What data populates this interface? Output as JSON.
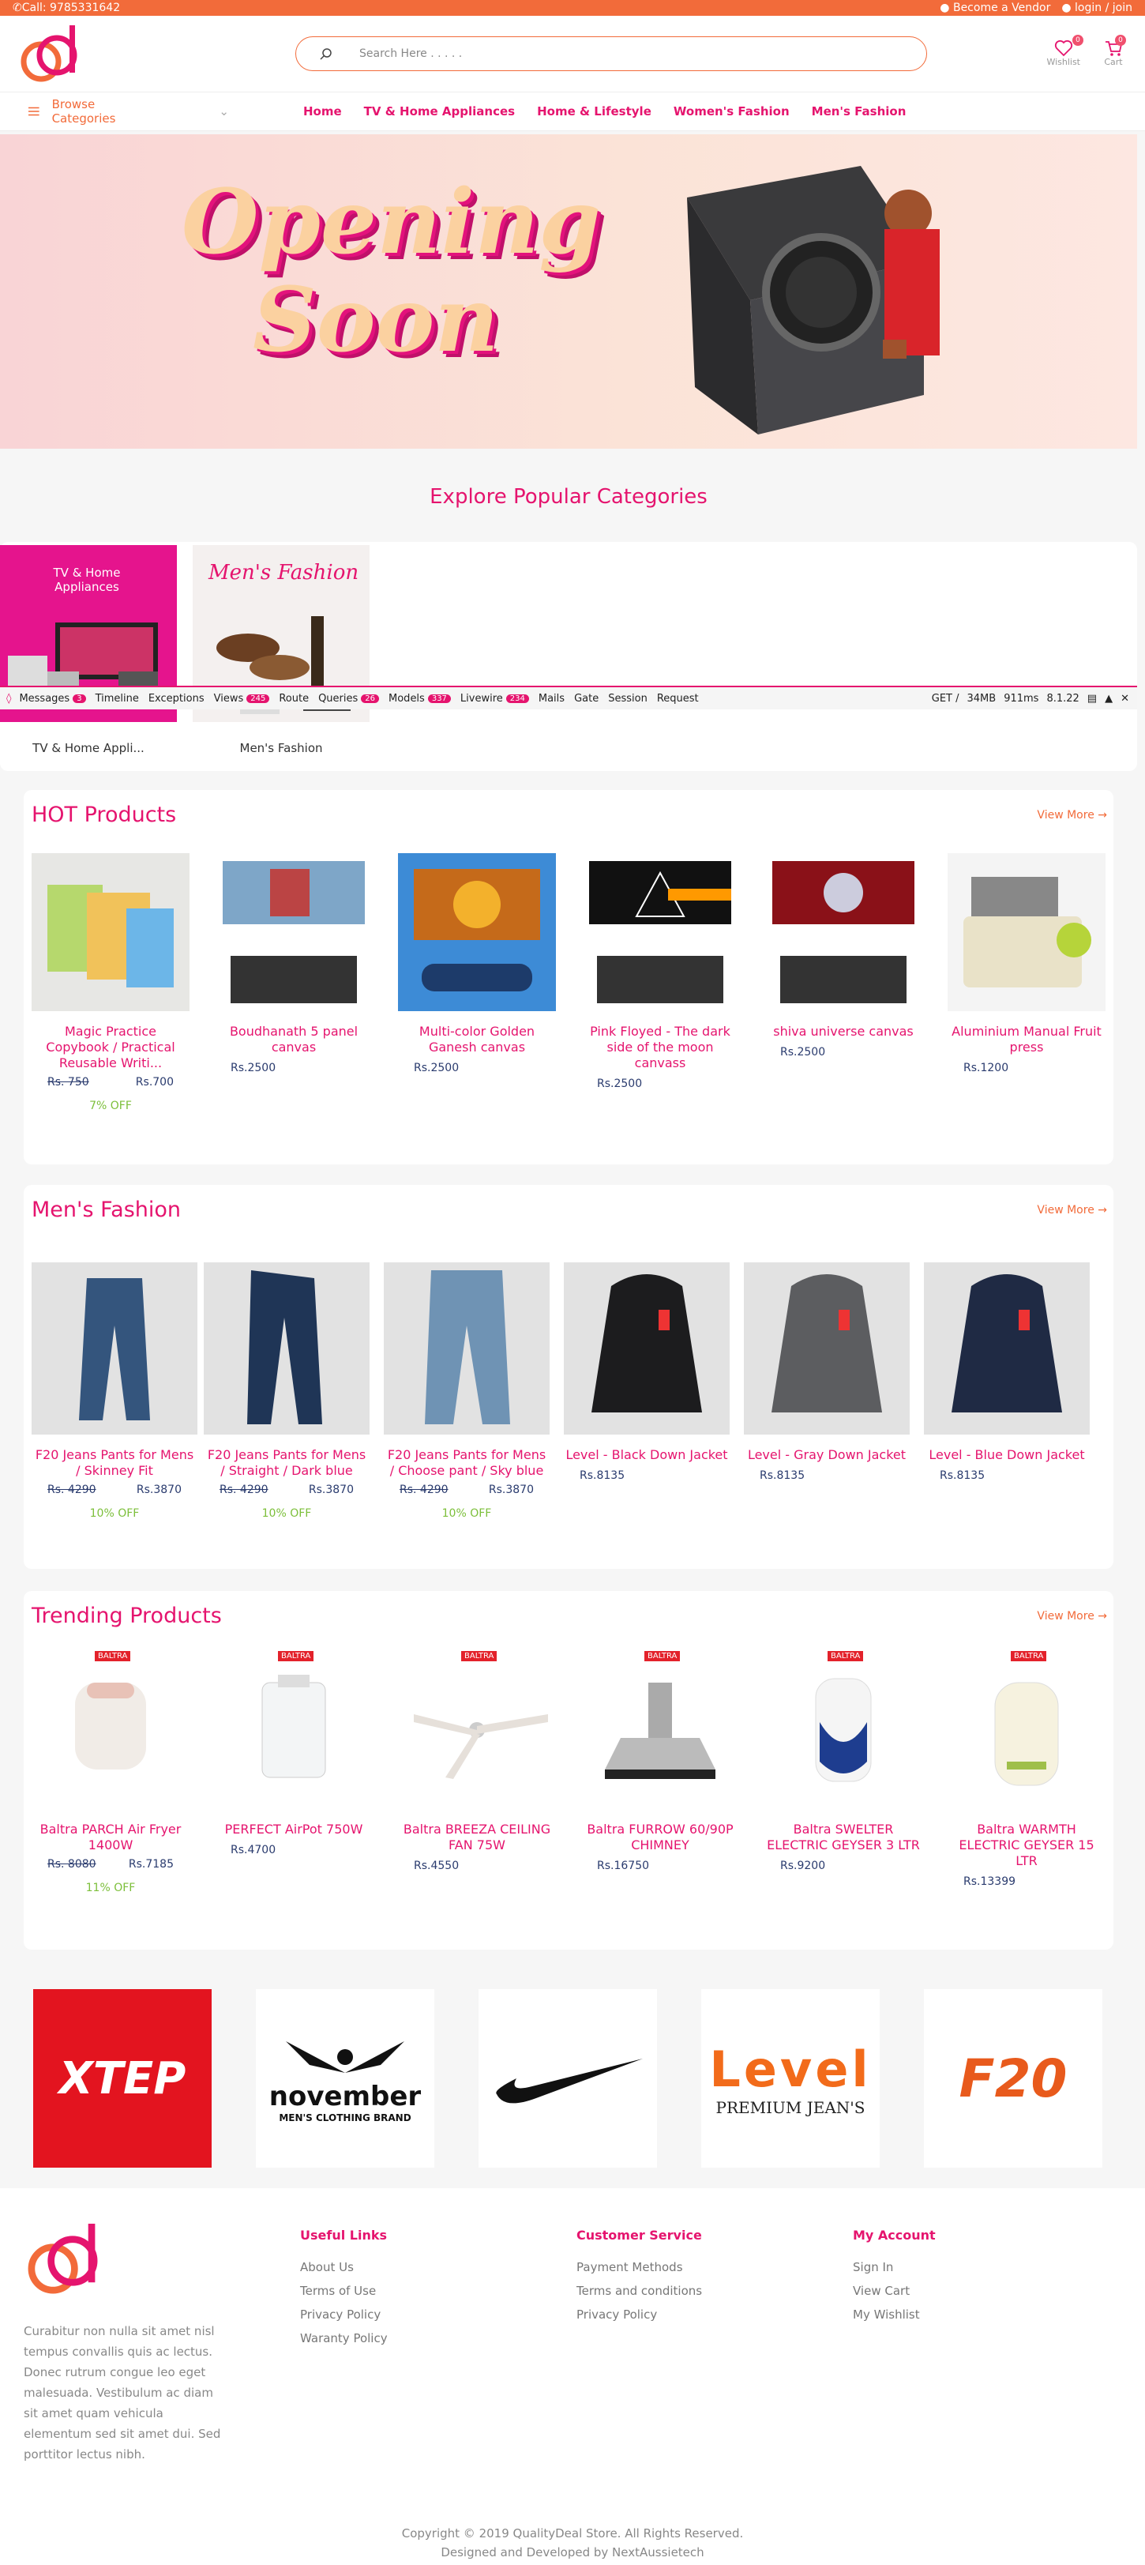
{
  "topbar": {
    "call": "✆Call: 9785331642",
    "vendor": "Become a Vendor",
    "login": "login / join"
  },
  "search": {
    "placeholder": "Search Here . . . . ."
  },
  "header": {
    "wishlist": "Wishlist",
    "cart": "Cart",
    "wishlist_count": "0",
    "cart_count": "0"
  },
  "nav": {
    "browse": "Browse Categories",
    "links": [
      "Home",
      "TV & Home Appliances",
      "Home & Lifestyle",
      "Women's Fashion",
      "Men's Fashion"
    ]
  },
  "hero": {
    "line1": "Opening",
    "line2": "Soon"
  },
  "categories": {
    "title": "Explore Popular Categories",
    "items": [
      {
        "overlay": "TV & Home Appliances",
        "label": "TV & Home Appli..."
      },
      {
        "overlay": "Men's Fashion",
        "label": "Men's Fashion"
      }
    ]
  },
  "debugbar": {
    "items": [
      "Messages",
      "Timeline",
      "Exceptions",
      "Views",
      "Route",
      "Queries",
      "Models",
      "Livewire",
      "Mails",
      "Gate",
      "Session",
      "Request"
    ],
    "badges": {
      "Messages": "3",
      "Views": "245",
      "Queries": "26",
      "Models": "337",
      "Livewire": "234"
    },
    "method": "GET /",
    "memory": "34MB",
    "time": "911ms",
    "version": "8.1.22"
  },
  "hot": {
    "title": "HOT Products",
    "more": "View More",
    "products": [
      {
        "name": "Magic Practice Copybook / Practical Reusable Writi...",
        "old": "Rs. 750",
        "price": "Rs.700",
        "off": "7% OFF"
      },
      {
        "name": "Boudhanath 5 panel canvas",
        "price": "Rs.2500"
      },
      {
        "name": "Multi-color Golden Ganesh canvas",
        "price": "Rs.2500"
      },
      {
        "name": "Pink Floyed - The dark side of the moon canvass",
        "price": "Rs.2500"
      },
      {
        "name": "shiva universe canvas",
        "price": "Rs.2500"
      },
      {
        "name": "Aluminium Manual Fruit press",
        "price": "Rs.1200"
      }
    ]
  },
  "mens": {
    "title": "Men's Fashion",
    "more": "View More",
    "products": [
      {
        "name": "F20 Jeans Pants for Mens / Skinney Fit",
        "old": "Rs. 4290",
        "price": "Rs.3870",
        "off": "10% OFF"
      },
      {
        "name": "F20 Jeans Pants for Mens / Straight / Dark blue",
        "old": "Rs. 4290",
        "price": "Rs.3870",
        "off": "10% OFF"
      },
      {
        "name": "F20 Jeans Pants for Mens / Choose pant / Sky blue",
        "old": "Rs. 4290",
        "price": "Rs.3870",
        "off": "10% OFF"
      },
      {
        "name": "Level - Black Down Jacket",
        "price": "Rs.8135"
      },
      {
        "name": "Level - Gray Down Jacket",
        "price": "Rs.8135"
      },
      {
        "name": "Level - Blue Down Jacket",
        "price": "Rs.8135"
      }
    ]
  },
  "trending": {
    "title": "Trending Products",
    "more": "View More",
    "brandtag": "BALTRA",
    "products": [
      {
        "name": "Baltra PARCH Air Fryer 1400W",
        "old": "Rs. 8080",
        "price": "Rs.7185",
        "off": "11% OFF"
      },
      {
        "name": "PERFECT AirPot 750W",
        "price": "Rs.4700"
      },
      {
        "name": "Baltra BREEZA CEILING FAN 75W",
        "price": "Rs.4550"
      },
      {
        "name": "Baltra FURROW 60/90P CHIMNEY",
        "price": "Rs.16750"
      },
      {
        "name": "Baltra SWELTER ELECTRIC GEYSER 3 LTR",
        "price": "Rs.9200"
      },
      {
        "name": "Baltra WARMTH ELECTRIC GEYSER 15 LTR",
        "price": "Rs.13399"
      }
    ]
  },
  "brands": [
    "XTEP",
    "november",
    "MEN'S CLOTHING BRAND",
    "Level",
    "PREMIUM JEAN'S",
    "F20"
  ],
  "footer": {
    "about": "Curabitur non nulla sit amet nisl tempus convallis quis ac lectus. Donec rutrum congue leo eget malesuada. Vestibulum ac diam sit amet quam vehicula elementum sed sit amet dui. Sed porttitor lectus nibh.",
    "useful": {
      "title": "Useful Links",
      "links": [
        "About Us",
        "Terms of Use",
        "Privacy Policy",
        "Waranty Policy"
      ]
    },
    "service": {
      "title": "Customer Service",
      "links": [
        "Payment Methods",
        "Terms and conditions",
        "Privacy Policy"
      ]
    },
    "account": {
      "title": "My Account",
      "links": [
        "Sign In",
        "View Cart",
        "My Wishlist"
      ]
    },
    "copyright": "Copyright © 2019 QualityDeal Store. All Rights Reserved.",
    "credit": "Designed and Developed by NextAussietech"
  },
  "colors": {
    "accent": "#f26b3a",
    "brand": "#e5146e",
    "discount": "#7cbf3a",
    "price": "#2a3b6e"
  }
}
